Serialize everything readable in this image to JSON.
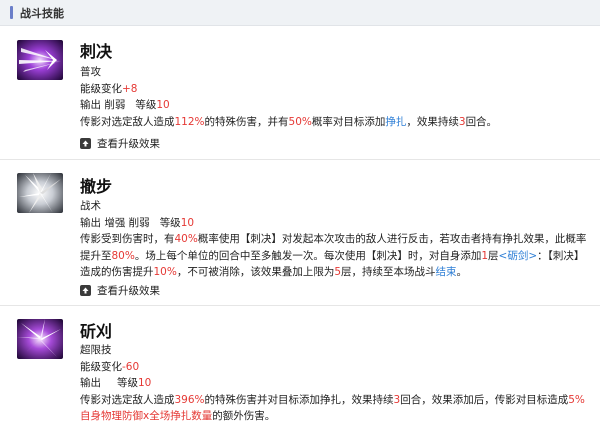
{
  "section_title": "战斗技能",
  "upgrade_label": "查看升级效果",
  "skills": [
    {
      "name": "刺决",
      "type": "普攻",
      "energy_label": "能级变化",
      "energy_value": "+8",
      "tags": "输出 削弱",
      "level_label": "等级",
      "level_value": "10",
      "desc": {
        "t1": "传影对选定敌人造成",
        "v1": "112%",
        "t2": "的特殊伤害，并有",
        "v2": "50%",
        "t3": "概率对目标添加",
        "link1": "挣扎",
        "t4": "，效果持续",
        "v3": "3",
        "t5": "回合。"
      },
      "icon": "purple-slash-icon"
    },
    {
      "name": "撤步",
      "type": "战术",
      "tags": "输出 增强 削弱",
      "level_label": "等级",
      "level_value": "10",
      "desc": {
        "t1": "传影受到伤害时，有",
        "v1": "40%",
        "t2": "概率使用【刺决】对发起本次攻击的敌人进行反击，若攻击者持有挣扎效果，此概率提升至",
        "v2": "80%",
        "t3": "。场上每个单位的回合中至多触发一次。每次使用【刺决】时，对自身添加",
        "v3": "1",
        "t4": "层",
        "link1": "<砺剑>",
        "t5": "：【刺决】造成的伤害提升",
        "v4": "10%",
        "t6": "，不可被消除，该效果叠加上限为",
        "v5": "5",
        "t7": "层，持续至本场战斗",
        "link2": "结束",
        "t8": "。"
      },
      "icon": "silver-spikes-icon"
    },
    {
      "name": "斫刈",
      "type": "超限技",
      "energy_label": "能级变化",
      "energy_value": "-60",
      "tags": "输出",
      "level_label": "等级",
      "level_value": "10",
      "desc": {
        "t1": "传影对选定敌人造成",
        "v1": "396%",
        "t2": "的特殊伤害并对目标添加挣扎，效果持续",
        "v2": "3",
        "t3": "回合，效果添加后，传影对目标造成",
        "v3": "5%自身物理防御x全场挣扎数量",
        "t4": "的额外伤害。"
      },
      "icon": "purple-burst-icon"
    }
  ],
  "colors": {
    "highlight_red": "#e53935",
    "link_blue": "#2f7fd6",
    "accent_bar": "#6b7fc9"
  }
}
